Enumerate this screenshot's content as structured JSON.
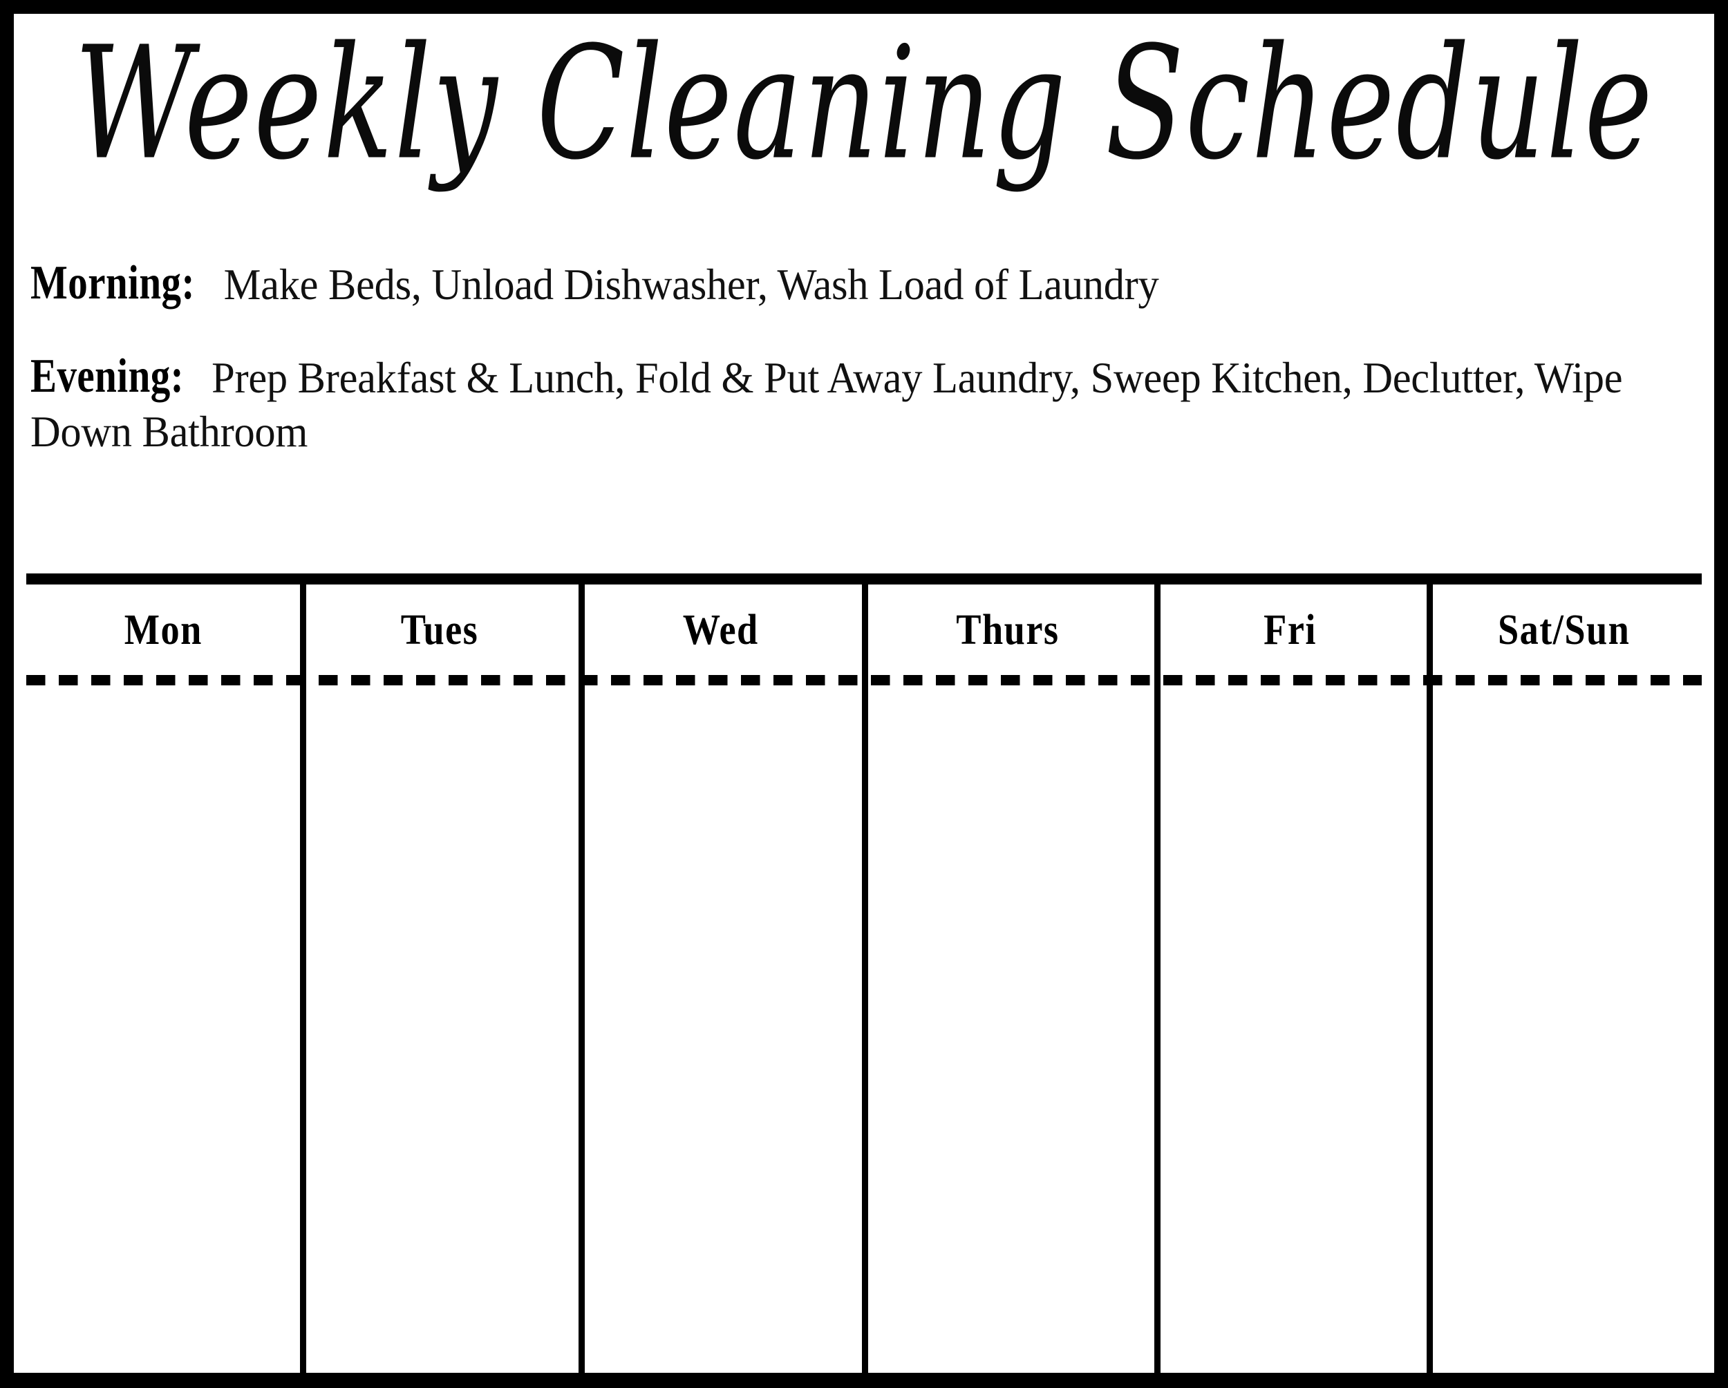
{
  "document": {
    "title": "Weekly Cleaning Schedule",
    "frame_color": "#000000",
    "paper_color": "#ffffff",
    "ink_color": "#000000"
  },
  "routines": [
    {
      "label": "Morning:",
      "tasks": "Make Beds, Unload Dishwasher, Wash Load of Laundry"
    },
    {
      "label": "Evening:",
      "tasks": "Prep Breakfast & Lunch, Fold & Put Away Laundry, Sweep Kitchen, Declutter, Wipe Down Bathroom"
    }
  ],
  "schedule": {
    "columns": [
      {
        "label": "Mon"
      },
      {
        "label": "Tues"
      },
      {
        "label": "Wed"
      },
      {
        "label": "Thurs"
      },
      {
        "label": "Fri"
      },
      {
        "label": "Sat/Sun"
      }
    ],
    "entries": [
      "",
      "",
      "",
      "",
      "",
      ""
    ]
  }
}
